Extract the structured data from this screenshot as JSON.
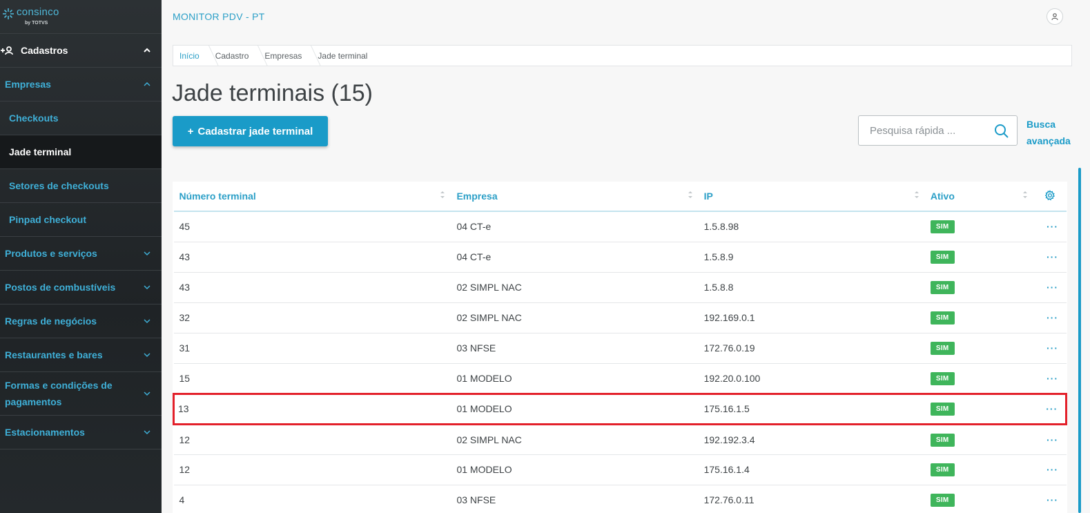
{
  "brand": {
    "name": "consinco",
    "sub": "by TOTVS"
  },
  "sidebar": {
    "section": {
      "label": "Cadastros"
    },
    "items": [
      {
        "label": "Empresas",
        "expanded": true
      },
      {
        "label": "Checkouts"
      },
      {
        "label": "Jade terminal",
        "active": true
      },
      {
        "label": "Setores de checkouts"
      },
      {
        "label": "Pinpad checkout"
      },
      {
        "label": "Produtos e serviços"
      },
      {
        "label": "Postos de combustíveis"
      },
      {
        "label": "Regras de negócios"
      },
      {
        "label": "Restaurantes e bares"
      },
      {
        "label": "Formas e condições de pagamentos"
      },
      {
        "label": "Estacionamentos"
      }
    ]
  },
  "header": {
    "title": "MONITOR PDV - PT"
  },
  "breadcrumb": [
    "Início",
    "Cadastro",
    "Empresas",
    "Jade terminal"
  ],
  "page": {
    "title": "Jade terminais (15)"
  },
  "actions": {
    "create_label": "Cadastrar jade terminal",
    "create_icon": "+"
  },
  "search": {
    "placeholder": "Pesquisa rápida ...",
    "advanced": "Busca avançada"
  },
  "table": {
    "columns": [
      "Número terminal",
      "Empresa",
      "IP",
      "Ativo"
    ],
    "rows": [
      {
        "numero": "45",
        "empresa": "04 CT-e",
        "ip": "1.5.8.98",
        "ativo": "SIM"
      },
      {
        "numero": "43",
        "empresa": "04 CT-e",
        "ip": "1.5.8.9",
        "ativo": "SIM"
      },
      {
        "numero": "43",
        "empresa": "02 SIMPL NAC",
        "ip": "1.5.8.8",
        "ativo": "SIM"
      },
      {
        "numero": "32",
        "empresa": "02 SIMPL NAC",
        "ip": "192.169.0.1",
        "ativo": "SIM"
      },
      {
        "numero": "31",
        "empresa": "03 NFSE",
        "ip": "172.76.0.19",
        "ativo": "SIM"
      },
      {
        "numero": "15",
        "empresa": "01 MODELO",
        "ip": "192.20.0.100",
        "ativo": "SIM"
      },
      {
        "numero": "13",
        "empresa": "01 MODELO",
        "ip": "175.16.1.5",
        "ativo": "SIM",
        "highlight": true
      },
      {
        "numero": "12",
        "empresa": "02 SIMPL NAC",
        "ip": "192.192.3.4",
        "ativo": "SIM"
      },
      {
        "numero": "12",
        "empresa": "01 MODELO",
        "ip": "175.16.1.4",
        "ativo": "SIM"
      },
      {
        "numero": "4",
        "empresa": "03 NFSE",
        "ip": "172.76.0.11",
        "ativo": "SIM"
      }
    ],
    "row_action": "···"
  },
  "colors": {
    "accent": "#1a9bc8",
    "badge": "#3fb55b",
    "highlight": "#e3202a"
  }
}
